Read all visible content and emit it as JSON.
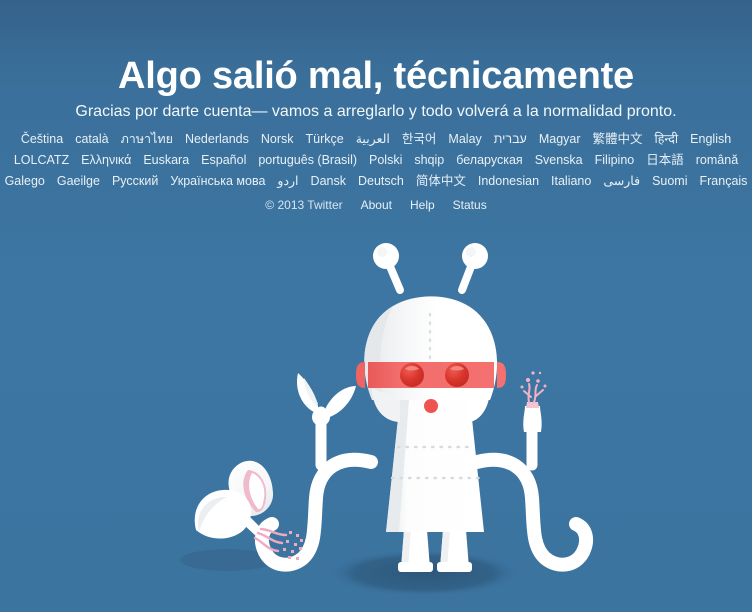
{
  "page": {
    "headline": "Algo salió mal, técnicamente",
    "subheadline": "Gracias por darte cuenta— vamos a arreglarlo y todo volverá a la normalidad pronto.",
    "background_color": "#3b74a0",
    "text_color": "#ffffff"
  },
  "languages": {
    "rows": [
      [
        "Čeština",
        "català",
        "ภาษาไทย",
        "Nederlands",
        "Norsk",
        "Türkçe",
        "العربية",
        "한국어",
        "Malay",
        "עברית",
        "Magyar",
        "繁體中文",
        "हिन्दी",
        "English"
      ],
      [
        "LOLCATZ",
        "Ελληνικά",
        "Euskara",
        "Español",
        "português (Brasil)",
        "Polski",
        "shqip",
        "беларуская",
        "Svenska",
        "Filipino",
        "日本語",
        "română"
      ],
      [
        "Galego",
        "Gaeilge",
        "Русский",
        "Українська мова",
        "اردو",
        "Dansk",
        "Deutsch",
        "简体中文",
        "Indonesian",
        "Italiano",
        "فارسی",
        "Suomi",
        "Français"
      ]
    ]
  },
  "footer": {
    "copyright": "© 2013 Twitter",
    "links": [
      "About",
      "Help",
      "Status"
    ]
  },
  "illustration": {
    "name": "broken-robot-illustration",
    "alt": "White robot with red visor standing next to a broken head shell",
    "body_color": "#ffffff",
    "visor_color": "#ef5350",
    "eye_color": "#d32f2f",
    "wire_color": "#f3b2c4",
    "shadow_color": "#2e5a80"
  }
}
